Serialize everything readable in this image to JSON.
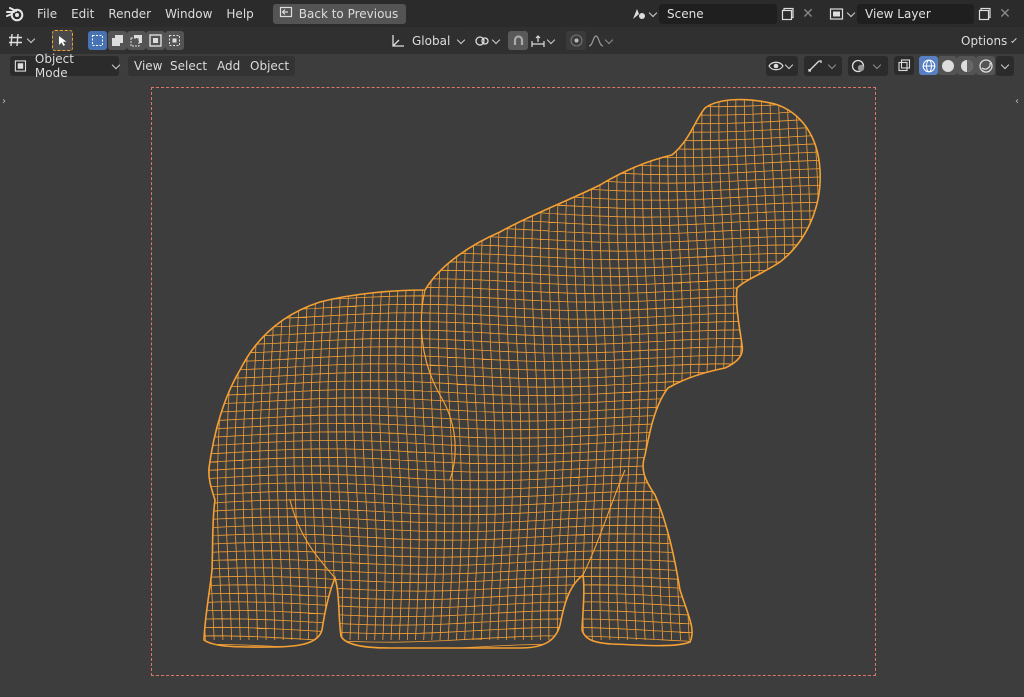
{
  "menubar": {
    "items": [
      "File",
      "Edit",
      "Render",
      "Window",
      "Help"
    ],
    "back_button": "Back to Previous"
  },
  "scene": {
    "name": "Scene"
  },
  "view_layer": {
    "name": "View Layer"
  },
  "toolbar": {
    "transform_orientation": "Global",
    "options_label": "Options"
  },
  "header": {
    "mode": "Object Mode",
    "menus": [
      "View",
      "Select",
      "Add",
      "Object"
    ]
  },
  "colors": {
    "wireframe": "#f5a033",
    "camera_frame": "#e0766a",
    "viewport_bg": "#3d3d3d",
    "active_shading": "#5680c2"
  },
  "viewport": {
    "object": "elephant-mesh",
    "shading": "wireframe"
  }
}
